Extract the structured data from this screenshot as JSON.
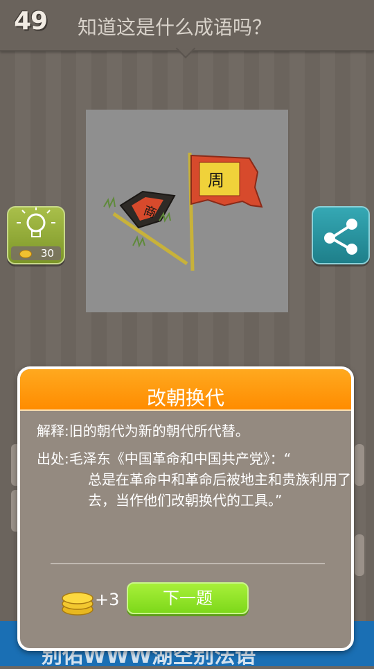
{
  "header": {
    "level": "49",
    "question": "知道这是什么成语吗？"
  },
  "hint": {
    "cost": "30"
  },
  "dialog": {
    "title": "改朝换代",
    "explanation": "解释:旧的朝代为新的朝代所代替。",
    "source_label": "出处:",
    "source_first": "毛泽东《中国革命和中国共产党》：“",
    "source_rest": "总是在革命中和革命后被地主和贵族利用了去，当作他们改朝换代的工具。”",
    "reward": "+3",
    "next_label": "下一题"
  },
  "picture": {
    "flag_new_char": "周",
    "flag_old_char": "商"
  },
  "banner": {
    "text": "别佑WWW湖空别法语"
  },
  "colors": {
    "accent": "#ff9a10",
    "next_button": "#8ee02a",
    "hint_button": "#8fa834",
    "share_button": "#2a94a0",
    "banner": "#1a6fb4"
  }
}
